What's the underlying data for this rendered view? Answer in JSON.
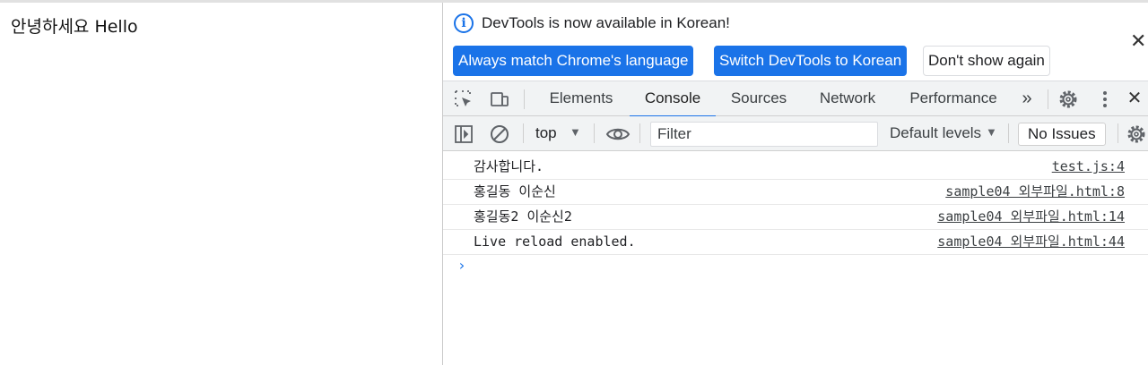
{
  "page": {
    "text": "안녕하세요 Hello"
  },
  "infobar": {
    "message": "DevTools is now available in Korean!",
    "buttons": {
      "always_match": "Always match Chrome's language",
      "switch": "Switch DevTools to Korean",
      "dont_show": "Don't show again"
    },
    "close_glyph": "✕"
  },
  "tabs": [
    {
      "label": "Elements",
      "active": false
    },
    {
      "label": "Console",
      "active": true
    },
    {
      "label": "Sources",
      "active": false
    },
    {
      "label": "Network",
      "active": false
    },
    {
      "label": "Performance",
      "active": false
    }
  ],
  "tabbar": {
    "more_glyph": "»",
    "close_glyph": "✕"
  },
  "toolbar": {
    "context": "top",
    "filter_placeholder": "Filter",
    "levels": "Default levels",
    "issues": "No Issues"
  },
  "console": {
    "messages": [
      {
        "text": "감사합니다.",
        "source": "test.js:4"
      },
      {
        "text": "홍길동 이순신",
        "source": "sample04 외부파일.html:8"
      },
      {
        "text": "홍길동2 이순신2",
        "source": "sample04 외부파일.html:14"
      },
      {
        "text": "Live reload enabled.",
        "source": "sample04 외부파일.html:44"
      }
    ],
    "prompt": "›"
  },
  "colors": {
    "accent": "#1a73e8",
    "toolbar_bg": "#f1f3f4"
  }
}
